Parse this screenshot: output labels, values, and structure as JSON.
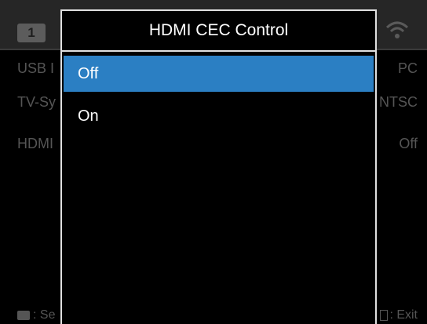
{
  "background_menu": {
    "tab_number": "1",
    "rows": [
      {
        "label": "USB I",
        "value": "PC"
      },
      {
        "label": "TV-Sy",
        "value": "NTSC"
      },
      {
        "label": "HDMI",
        "value": "Off"
      }
    ],
    "footer_left_label": ": Se",
    "footer_right_label": ": Exit"
  },
  "dialog": {
    "title": "HDMI CEC Control",
    "options": [
      {
        "label": "Off",
        "selected": true
      },
      {
        "label": "On",
        "selected": false
      }
    ]
  },
  "colors": {
    "selection": "#2b7fc3",
    "border": "#e0e0e0",
    "dim_text": "#555555"
  },
  "icons": {
    "tab": "camera-tab-icon",
    "wifi": "wifi-icon",
    "dpad": "dpad-icon",
    "menu": "menu-icon"
  }
}
